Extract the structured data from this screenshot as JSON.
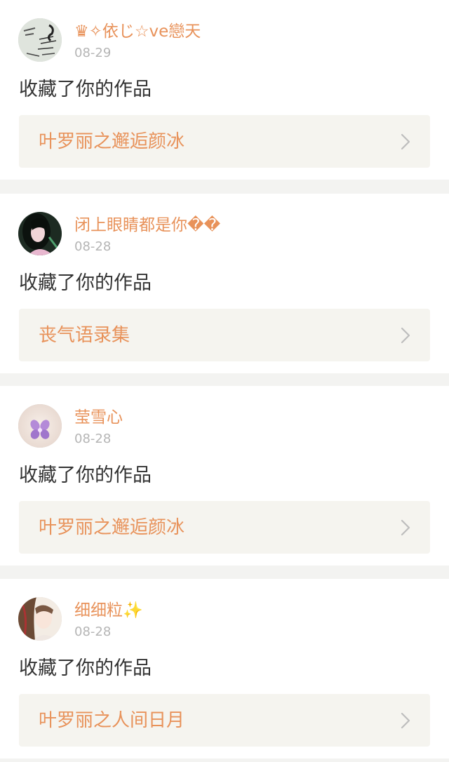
{
  "notifications": [
    {
      "username": "♛✧依じ☆ve戀天",
      "date": "08-29",
      "action": "收藏了你的作品",
      "work_title": "叶罗丽之邂逅颜冰",
      "avatar_icon": "calligraphy-avatar-icon"
    },
    {
      "username": "闭上眼睛都是你��",
      "date": "08-28",
      "action": "收藏了你的作品",
      "work_title": "丧气语录集",
      "avatar_icon": "anime-girl-avatar-icon"
    },
    {
      "username": "莹雪心",
      "date": "08-28",
      "action": "收藏了你的作品",
      "work_title": "叶罗丽之邂逅颜冰",
      "avatar_icon": "purple-flower-avatar-icon"
    },
    {
      "username": "细细粒✨",
      "date": "08-28",
      "action": "收藏了你的作品",
      "work_title": "叶罗丽之人间日月",
      "avatar_icon": "anime-character-avatar-icon"
    }
  ],
  "colors": {
    "accent": "#e8925a",
    "action_text": "#333333",
    "date_text": "#b5b5b5",
    "link_bg": "#f5f4ef",
    "separator": "#f3f3f1"
  }
}
